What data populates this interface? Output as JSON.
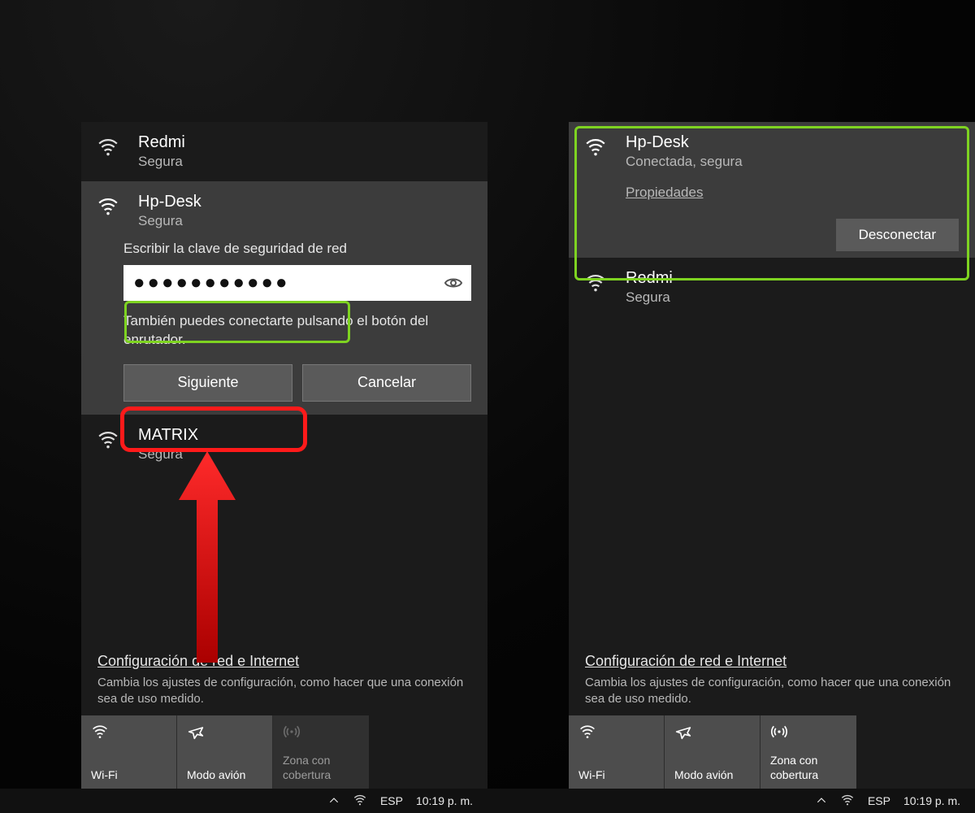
{
  "left": {
    "networks": [
      {
        "name": "Redmi",
        "status": "Segura"
      },
      {
        "name": "Hp-Desk",
        "status": "Segura",
        "prompt": "Escribir la clave de seguridad de red",
        "password_masked": "●●●●●●●●●●●",
        "hint": "También puedes conectarte pulsando el botón del enrutador.",
        "next": "Siguiente",
        "cancel": "Cancelar"
      },
      {
        "name": "MATRIX",
        "status": "Segura"
      }
    ],
    "footer": {
      "link": "Configuración de red e Internet",
      "desc": "Cambia los ajustes de configuración, como hacer que una conexión sea de uso medido."
    },
    "tiles": {
      "wifi": "Wi-Fi",
      "airplane": "Modo avión",
      "hotspot": "Zona con cobertura"
    },
    "taskbar": {
      "lang": "ESP",
      "time": "10:19 p. m."
    }
  },
  "right": {
    "connected": {
      "name": "Hp-Desk",
      "status": "Conectada, segura",
      "props": "Propiedades",
      "disconnect": "Desconectar"
    },
    "other": {
      "name": "Redmi",
      "status": "Segura"
    },
    "footer": {
      "link": "Configuración de red e Internet",
      "desc": "Cambia los ajustes de configuración, como hacer que una conexión sea de uso medido."
    },
    "tiles": {
      "wifi": "Wi-Fi",
      "airplane": "Modo avión",
      "hotspot": "Zona con cobertura"
    },
    "taskbar": {
      "lang": "ESP",
      "time": "10:19 p. m."
    }
  }
}
